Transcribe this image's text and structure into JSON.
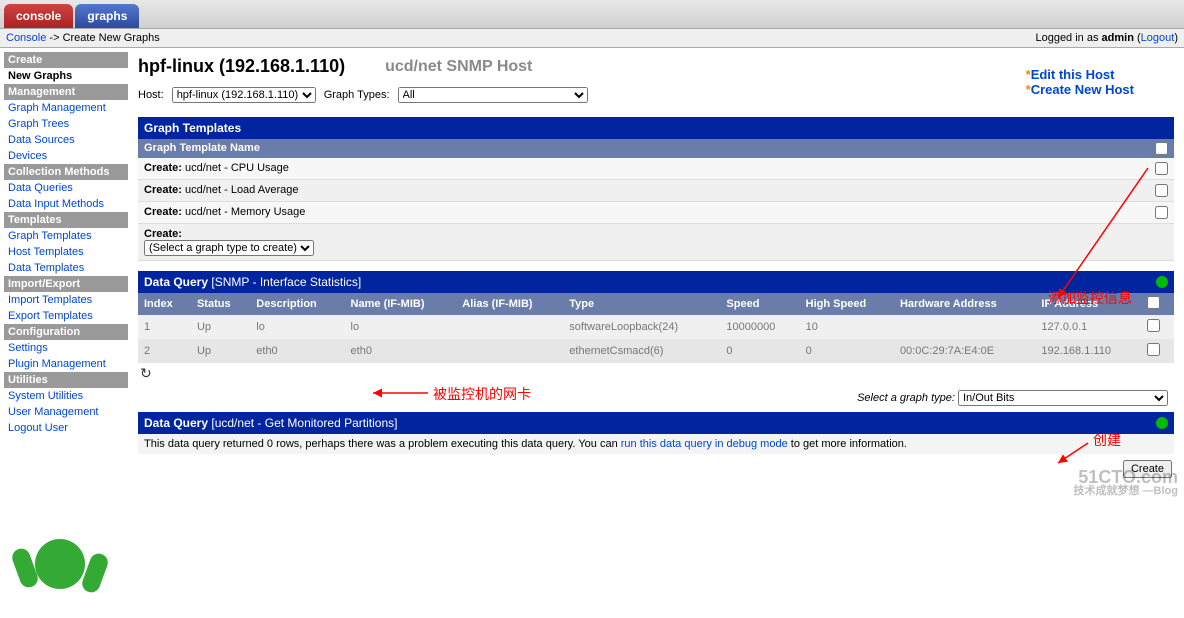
{
  "tabs": {
    "console": "console",
    "graphs": "graphs"
  },
  "breadcrumb": {
    "console": "Console",
    "arrow": " -> ",
    "page": "Create New Graphs",
    "logged_prefix": "Logged in as ",
    "user": "admin",
    "logout": "Logout"
  },
  "sidebar": {
    "groups": [
      {
        "header": "Create",
        "items": [
          {
            "label": "New Graphs",
            "sel": true
          }
        ]
      },
      {
        "header": "Management",
        "items": [
          {
            "label": "Graph Management"
          },
          {
            "label": "Graph Trees"
          },
          {
            "label": "Data Sources"
          },
          {
            "label": "Devices"
          }
        ]
      },
      {
        "header": "Collection Methods",
        "items": [
          {
            "label": "Data Queries"
          },
          {
            "label": "Data Input Methods"
          }
        ]
      },
      {
        "header": "Templates",
        "items": [
          {
            "label": "Graph Templates"
          },
          {
            "label": "Host Templates"
          },
          {
            "label": "Data Templates"
          }
        ]
      },
      {
        "header": "Import/Export",
        "items": [
          {
            "label": "Import Templates"
          },
          {
            "label": "Export Templates"
          }
        ]
      },
      {
        "header": "Configuration",
        "items": [
          {
            "label": "Settings"
          },
          {
            "label": "Plugin Management"
          }
        ]
      },
      {
        "header": "Utilities",
        "items": [
          {
            "label": "System Utilities"
          },
          {
            "label": "User Management"
          },
          {
            "label": "Logout User"
          }
        ]
      }
    ]
  },
  "title": {
    "host": "hpf-linux (192.168.1.110)",
    "type": "ucd/net SNMP Host"
  },
  "hostRow": {
    "hostLabel": "Host:",
    "hostSelected": "hpf-linux (192.168.1.110)",
    "graphTypesLabel": "Graph Types:",
    "graphTypesSelected": "All"
  },
  "starLinks": {
    "edit": "Edit this Host",
    "create": "Create New Host",
    "star": "*"
  },
  "graphTemplates": {
    "section": "Graph Templates",
    "colName": "Graph Template Name",
    "rows": [
      {
        "prefix": "Create:",
        "name": "ucd/net - CPU Usage"
      },
      {
        "prefix": "Create:",
        "name": "ucd/net - Load Average"
      },
      {
        "prefix": "Create:",
        "name": "ucd/net - Memory Usage"
      }
    ],
    "lastPrefix": "Create:",
    "lastSelect": "(Select a graph type to create)"
  },
  "dq1": {
    "section": "Data Query",
    "name": "[SNMP - Interface Statistics]",
    "cols": [
      "Index",
      "Status",
      "Description",
      "Name (IF-MIB)",
      "Alias (IF-MIB)",
      "Type",
      "Speed",
      "High Speed",
      "Hardware Address",
      "IP Address"
    ],
    "rows": [
      {
        "index": "1",
        "status": "Up",
        "desc": "lo",
        "name": "lo",
        "alias": "",
        "type": "softwareLoopback(24)",
        "speed": "10000000",
        "hspeed": "10",
        "hw": "",
        "ip": "127.0.0.1"
      },
      {
        "index": "2",
        "status": "Up",
        "desc": "eth0",
        "name": "eth0",
        "alias": "",
        "type": "ethernetCsmacd(6)",
        "speed": "0",
        "hspeed": "0",
        "hw": "00:0C:29:7A:E4:0E",
        "ip": "192.168.1.110"
      }
    ],
    "selectLabel": "Select a graph type:",
    "selectValue": "In/Out Bits"
  },
  "dq2": {
    "section": "Data Query",
    "name": "[ucd/net - Get Monitored Partitions]",
    "note_pre": "This data query returned 0 rows, perhaps there was a problem executing this data query. You can ",
    "note_link": "run this data query in debug mode",
    "note_post": " to get more information."
  },
  "createBtn": "Create",
  "annotations": {
    "a1": "添加监控信息",
    "a2": "被监控机的网卡",
    "a3": "创建"
  },
  "watermark": {
    "big": "51CTO.com",
    "small": "技术成就梦想 —Blog"
  }
}
